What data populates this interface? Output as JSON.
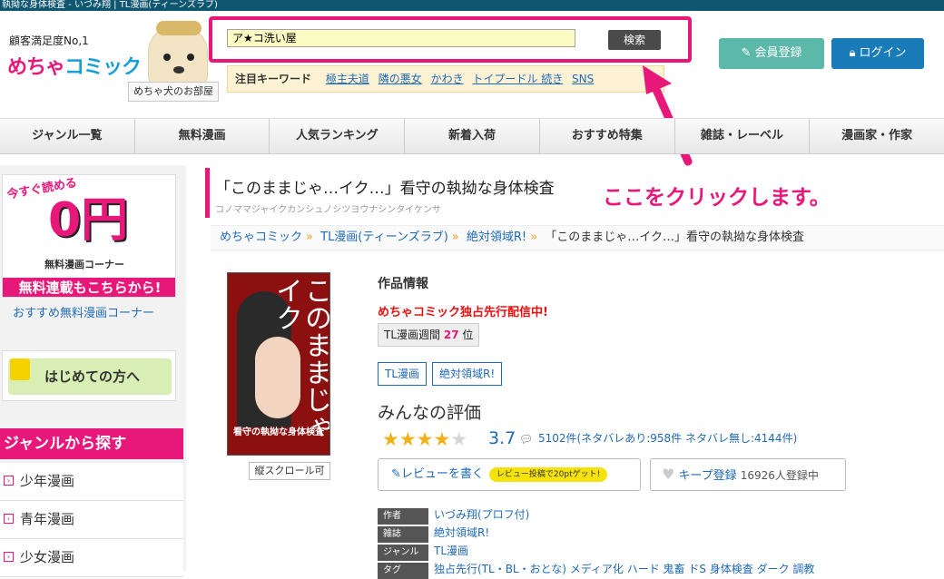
{
  "window_title": "執拗な身体検査 - いづみ翔 | TL漫画(ティーンズラブ)",
  "header": {
    "tagline": "顧客満足度No,1",
    "logo_part1": "めちゃ",
    "logo_part2": "コミック",
    "dog_label": "めちゃ犬のお部屋",
    "search_value": "ア★コ洗い屋",
    "search_button": "検索",
    "keywords_title": "注目キーワード",
    "keywords": [
      "極主夫道",
      "隣の悪女",
      "かわき",
      "トイプードル 続き",
      "SNS"
    ],
    "register_button": "会員登録",
    "login_button": "ログイン"
  },
  "nav": [
    "ジャンル一覧",
    "無料漫画",
    "人気ランキング",
    "新着入荷",
    "おすすめ特集",
    "雑誌・レーベル",
    "漫画家・作家"
  ],
  "sidebar": {
    "banner_top": "今すぐ読める",
    "banner_main": "0円",
    "banner_sub": "無料漫画コーナー",
    "banner_bottom": "無料連載もこちらから!",
    "banner_link": "おすすめ無料漫画コーナー",
    "beginner": "はじめての方へ",
    "genre_head": "ジャンルから探す",
    "genres": [
      "少年漫画",
      "青年漫画",
      "少女漫画"
    ]
  },
  "title": {
    "main": "「このままじゃ…イク…」看守の執拗な身体検査",
    "kana": "コノママジャイクカンシュノシツヨウナシンタイケンサ"
  },
  "annotation": "ここをクリックします。",
  "breadcrumb": [
    "めちゃコミック",
    "TL漫画(ティーンズラブ)",
    "絶対領域R!",
    "「このままじゃ…イク…」看守の執拗な身体検査"
  ],
  "cover": {
    "vertical_title": "このままじゃイク",
    "subtitle": "看守の執拗な身体検査",
    "scroll_badge": "縦スクロール可"
  },
  "info": {
    "heading": "作品情報",
    "exclusive": "めちゃコミック独占先行配信中!",
    "rank_prefix": "TL漫画週間",
    "rank_num": "27",
    "rank_suffix": "位",
    "tags": [
      "TL漫画",
      "絶対領域R!"
    ],
    "rating_head": "みんなの評価",
    "score": "3.7",
    "review_text": "5102件(ネタバレあり:958件 ネタバレ無し:4144件)",
    "review_button": "レビューを書く",
    "review_badge": "レビュー投稿で20ptゲット!",
    "keep_button": "キープ登録",
    "keep_count": "16926人登録中",
    "meta": [
      {
        "label": "作者",
        "value": "いづみ翔(プロフ付)"
      },
      {
        "label": "雑誌",
        "value": "絶対領域R!"
      },
      {
        "label": "ジャンル",
        "value": "TL漫画"
      },
      {
        "label": "タグ",
        "value": "独占先行(TL・BL・おとな) メディア化 ハード 鬼畜 ドS 身体検査 ダーク 調教"
      }
    ]
  },
  "colors": {
    "accent": "#e8187a",
    "link": "#1f6ab7",
    "topbar": "#0f5670"
  }
}
